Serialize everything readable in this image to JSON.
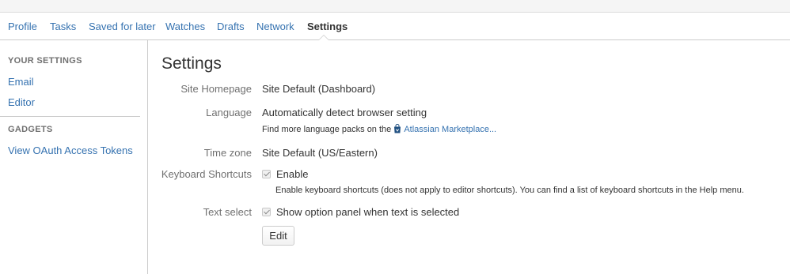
{
  "tabs": [
    {
      "label": "Profile"
    },
    {
      "label": "Tasks"
    },
    {
      "label": "Saved for later"
    },
    {
      "label": "Watches"
    },
    {
      "label": "Drafts"
    },
    {
      "label": "Network"
    },
    {
      "label": "Settings",
      "active": true
    }
  ],
  "sidebar": {
    "your_settings_heading": "YOUR SETTINGS",
    "items": [
      {
        "label": "Email"
      },
      {
        "label": "Editor"
      }
    ],
    "gadgets_heading": "GADGETS",
    "gadget_items": [
      {
        "label": "View OAuth Access Tokens"
      }
    ]
  },
  "main": {
    "title": "Settings",
    "site_homepage": {
      "label": "Site Homepage",
      "value": "Site Default (Dashboard)"
    },
    "language": {
      "label": "Language",
      "value": "Automatically detect browser setting",
      "help_prefix": "Find more language packs on the",
      "help_link": "Atlassian Marketplace..."
    },
    "time_zone": {
      "label": "Time zone",
      "value": "Site Default (US/Eastern)"
    },
    "keyboard_shortcuts": {
      "label": "Keyboard Shortcuts",
      "checkbox_label": "Enable",
      "checked": true,
      "help": "Enable keyboard shortcuts (does not apply to editor shortcuts). You can find a list of keyboard shortcuts in the Help menu."
    },
    "text_select": {
      "label": "Text select",
      "checkbox_label": "Show option panel when text is selected",
      "checked": true
    },
    "edit_button": "Edit"
  },
  "colors": {
    "link": "#3572b0",
    "text": "#333333",
    "muted": "#707070",
    "border": "#cccccc"
  },
  "icons": {
    "marketplace": "shopping-bag-icon",
    "checkbox": "check-icon"
  }
}
